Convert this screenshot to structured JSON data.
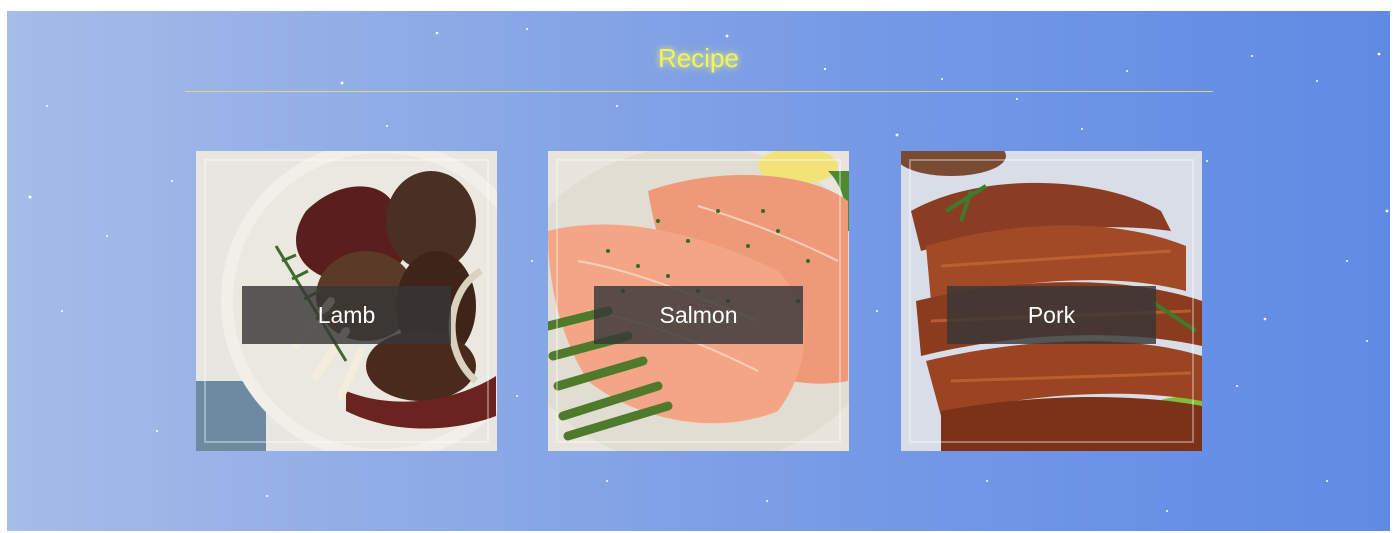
{
  "page": {
    "title": "Recipe"
  },
  "recipes": [
    {
      "label": "Lamb"
    },
    {
      "label": "Salmon"
    },
    {
      "label": "Pork"
    }
  ],
  "colors": {
    "title": "#f2f25a",
    "rule": "#dfe06a",
    "label_bg": "rgba(55,55,55,0.82)",
    "background_start": "#a6bce9",
    "background_end": "#5f8be4"
  }
}
